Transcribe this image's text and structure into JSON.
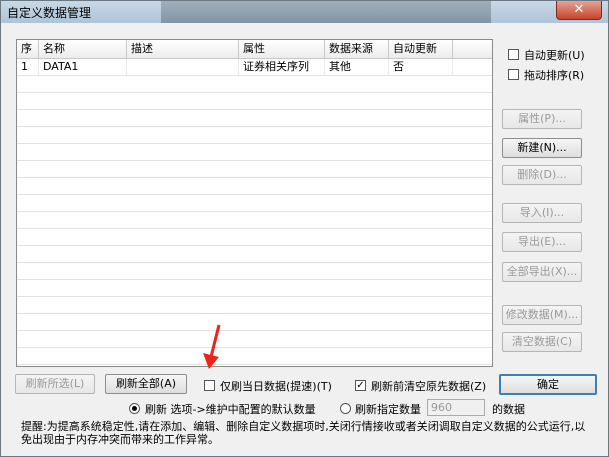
{
  "window": {
    "title": "自定义数据管理",
    "close_symbol": "✕"
  },
  "grid": {
    "columns": [
      "序",
      "名称",
      "描述",
      "属性",
      "数据来源",
      "自动更新"
    ],
    "rows": [
      {
        "seq": "1",
        "name": "DATA1",
        "desc": "",
        "attr": "证券相关序列",
        "source": "其他",
        "auto": "否"
      }
    ]
  },
  "right_panel": {
    "auto_update_label": "自动更新(U)",
    "drag_sort_label": "拖动排序(R)",
    "buttons": {
      "properties": "属性(P)...",
      "new": "新建(N)...",
      "delete": "删除(D)...",
      "import": "导入(I)...",
      "export": "导出(E)...",
      "export_all": "全部导出(X)...",
      "modify_data": "修改数据(M)...",
      "clear_data": "清空数据(C)",
      "ok": "确定"
    }
  },
  "bottom": {
    "refresh_selected": "刷新所选(L)",
    "refresh_all": "刷新全部(A)",
    "today_only_label": "仅刷当日数据(提速)(T)",
    "clear_before_label": "刷新前清空原先数据(Z)",
    "radio_default_label": "刷新 选项->维护中配置的默认数量",
    "radio_count_label": "刷新指定数量",
    "count_value": "960",
    "count_suffix": "的数据",
    "tip": "提醒:为提高系统稳定性,请在添加、编辑、删除自定义数据项时,关闭行情接收或者关闭调取自定义数据的公式运行,以免出现由于内存冲突而带来的工作异常。"
  },
  "colors": {
    "accent_arrow": "#e8261a",
    "default_button_border": "#3c7fb1"
  }
}
